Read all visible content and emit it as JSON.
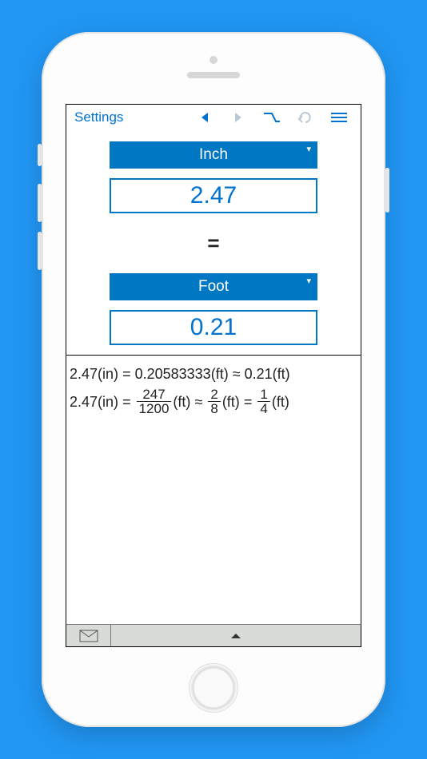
{
  "toolbar": {
    "settings_label": "Settings"
  },
  "conversion": {
    "from_unit": "Inch",
    "from_value": "2.47",
    "equals": "=",
    "to_unit": "Foot",
    "to_value": "0.21"
  },
  "details": {
    "line1": {
      "lhs_value": "2.47",
      "lhs_unit": "(in)",
      "op1": "=",
      "dec_value": "0.20583333",
      "dec_unit": "(ft)",
      "op2": "≈",
      "approx_value": "0.21",
      "approx_unit": "(ft)"
    },
    "line2": {
      "lhs_value": "2.47",
      "lhs_unit": "(in)",
      "op1": "=",
      "frac1_num": "247",
      "frac1_den": "1200",
      "frac1_unit": "(ft)",
      "op2": "≈",
      "frac2_num": "2",
      "frac2_den": "8",
      "frac2_unit": "(ft)",
      "op3": "=",
      "frac3_num": "1",
      "frac3_den": "4",
      "frac3_unit": "(ft)"
    }
  },
  "colors": {
    "accent": "#0077c2",
    "link": "#0073d1",
    "page_bg": "#2196f3"
  }
}
